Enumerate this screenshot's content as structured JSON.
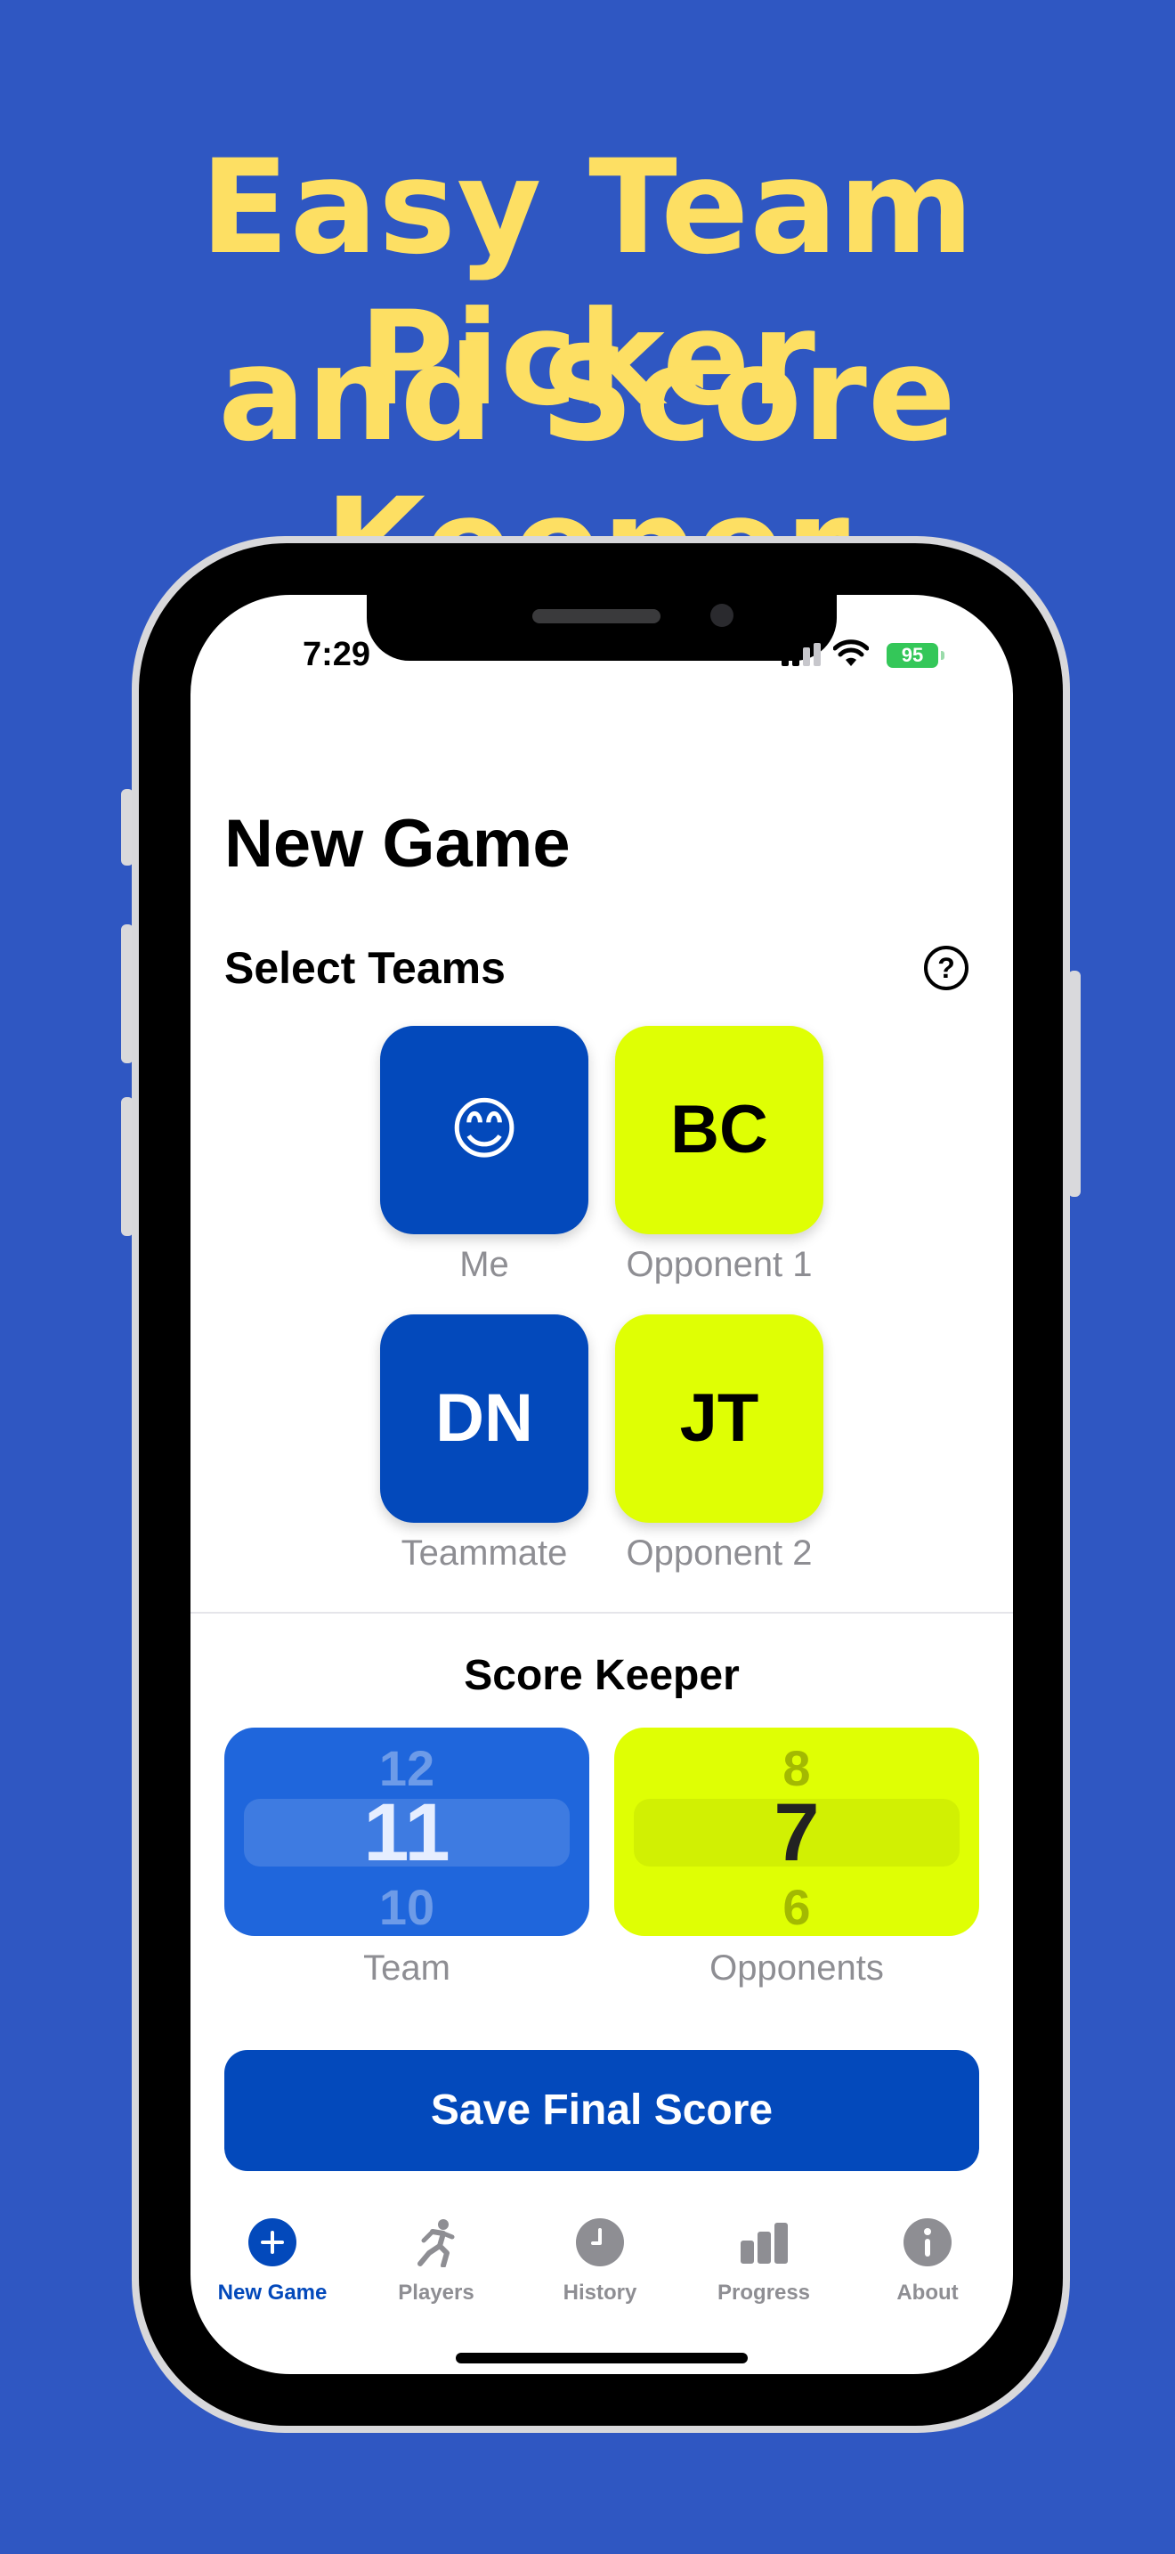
{
  "promo": {
    "line1": "Easy Team Picker",
    "line2": "and Score Keeper"
  },
  "status_bar": {
    "time": "7:29",
    "battery": "95"
  },
  "page": {
    "title": "New Game",
    "section_title": "Select Teams",
    "help_icon": "?"
  },
  "teams": [
    {
      "initials": "😊",
      "label": "Me",
      "color": "#0349bb"
    },
    {
      "initials": "BC",
      "label": "Opponent 1",
      "color": "#dfff04"
    },
    {
      "initials": "DN",
      "label": "Teammate",
      "color": "#0349bb"
    },
    {
      "initials": "JT",
      "label": "Opponent 2",
      "color": "#dfff04"
    }
  ],
  "score_keeper": {
    "title": "Score Keeper",
    "team": {
      "prev": "12",
      "current": "11",
      "next": "10",
      "label": "Team"
    },
    "opponents": {
      "prev": "8",
      "current": "7",
      "next": "6",
      "label": "Opponents"
    }
  },
  "save_button": "Save Final Score",
  "tabs": [
    {
      "label": "New Game",
      "icon": "plus-circle-icon",
      "active": true
    },
    {
      "label": "Players",
      "icon": "runner-icon",
      "active": false
    },
    {
      "label": "History",
      "icon": "clock-icon",
      "active": false
    },
    {
      "label": "Progress",
      "icon": "bar-chart-icon",
      "active": false
    },
    {
      "label": "About",
      "icon": "info-icon",
      "active": false
    }
  ],
  "colors": {
    "background": "#2f57c2",
    "headline": "#fddf63",
    "primary_blue": "#0349bb",
    "lime": "#dfff04"
  }
}
